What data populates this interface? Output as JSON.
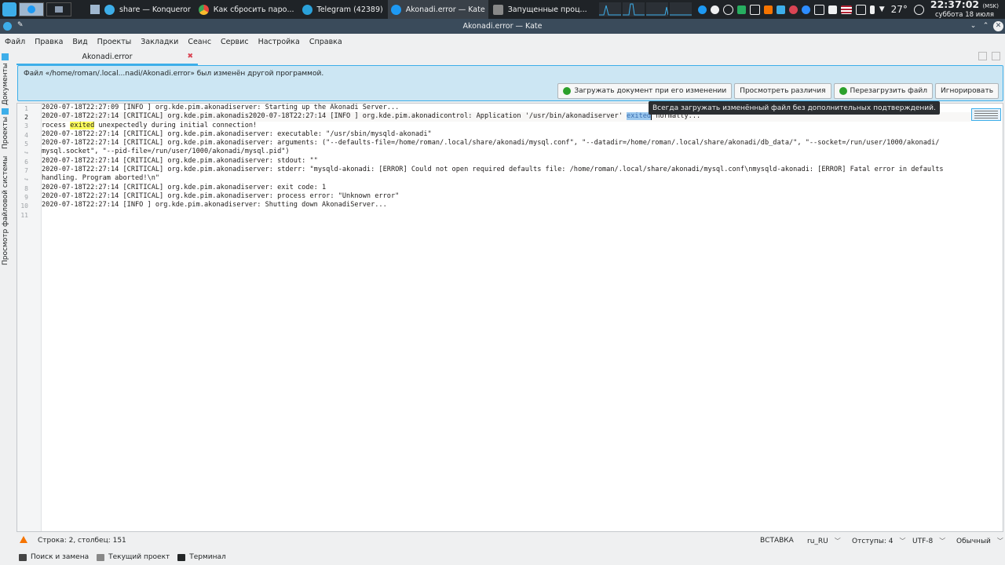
{
  "taskbar": {
    "tasks": [
      {
        "label": "share — Konqueror",
        "icon": "konqueror-icon",
        "color": "#3daee9"
      },
      {
        "label": "Как сбросить паро...",
        "icon": "chrome-icon",
        "color": "#e8453c"
      },
      {
        "label": "Telegram (42389)",
        "icon": "telegram-icon",
        "color": "#2aa1da"
      },
      {
        "label": "Akonadi.error — Kate",
        "icon": "kate-icon",
        "color": "#1d99f3"
      },
      {
        "label": "Запущенные проц...",
        "icon": "terminal-icon",
        "color": "#888888"
      }
    ],
    "weather": "27°",
    "clock_time": "22:37:02",
    "clock_tz": "(MSK)",
    "clock_date": "суббота 18 июля"
  },
  "window": {
    "title": "Akonadi.error — Kate"
  },
  "menu": [
    "Файл",
    "Правка",
    "Вид",
    "Проекты",
    "Закладки",
    "Сеанс",
    "Сервис",
    "Настройка",
    "Справка"
  ],
  "sidebar": {
    "documents": "Документы",
    "projects": "Проекты",
    "filesystem": "Просмотр файловой системы"
  },
  "tab": {
    "label": "Akonadi.error"
  },
  "notice": {
    "message": "Файл «/home/roman/.local...nadi/Akonadi.error» был изменён другой программой.",
    "btn_autoreload": "Загружать документ при его изменении",
    "btn_diff": "Просмотреть различия",
    "btn_reload": "Перезагрузить файл",
    "btn_ignore": "Игнорировать"
  },
  "tooltip": "Всегда загружать изменённый файл без дополнительных подтверждений.",
  "editor": {
    "gutter": [
      "1",
      "2",
      "3",
      "4",
      "5",
      "6",
      "7",
      "8",
      "9",
      "10",
      "11"
    ],
    "lines": {
      "l1": "2020-07-18T22:27:09 [INFO ] org.kde.pim.akonadiserver: Starting up the Akonadi Server...",
      "l2a": "2020-07-18T22:27:14 [CRITICAL] org.kde.pim.akonadis2020-07-18T22:27:14 [INFO ] org.kde.pim.akonadicontrol: Application '/usr/bin/akonadiserver' ",
      "l2sel": "exited",
      "l2b": " normally...",
      "l3a": "rocess ",
      "l3hl": "exited",
      "l3b": " unexpectedly during initial connection!",
      "l4": "2020-07-18T22:27:14 [CRITICAL] org.kde.pim.akonadiserver: executable: \"/usr/sbin/mysqld-akonadi\"",
      "l5a": "2020-07-18T22:27:14 [CRITICAL] org.kde.pim.akonadiserver: arguments: (\"--defaults-file=/home/roman/.local/share/akonadi/mysql.conf\", \"--datadir=/home/roman/.local/share/akonadi/db_data/\", \"--socket=/run/user/1000/akonadi/",
      "l5b": "mysql.socket\", \"--pid-file=/run/user/1000/akonadi/mysql.pid\")",
      "l6": "2020-07-18T22:27:14 [CRITICAL] org.kde.pim.akonadiserver: stdout: \"\"",
      "l7a": "2020-07-18T22:27:14 [CRITICAL] org.kde.pim.akonadiserver: stderr: \"mysqld-akonadi: [ERROR] Could not open required defaults file: /home/roman/.local/share/akonadi/mysql.conf\\nmysqld-akonadi: [ERROR] Fatal error in defaults",
      "l7b": "handling. Program aborted!\\n\"",
      "l8": "2020-07-18T22:27:14 [CRITICAL] org.kde.pim.akonadiserver: exit code: 1",
      "l9": "2020-07-18T22:27:14 [CRITICAL] org.kde.pim.akonadiserver: process error: \"Unknown error\"",
      "l10": "2020-07-18T22:27:14 [INFO ] org.kde.pim.akonadiserver: Shutting down AkonadiServer..."
    }
  },
  "status": {
    "position": "Строка: 2, столбец: 151",
    "mode": "ВСТАВКА",
    "language": "ru_RU",
    "indent": "Отступы: 4",
    "encoding": "UTF-8",
    "syntax": "Обычный"
  },
  "tools": {
    "search": "Поиск и замена",
    "project": "Текущий проект",
    "terminal": "Терминал"
  }
}
